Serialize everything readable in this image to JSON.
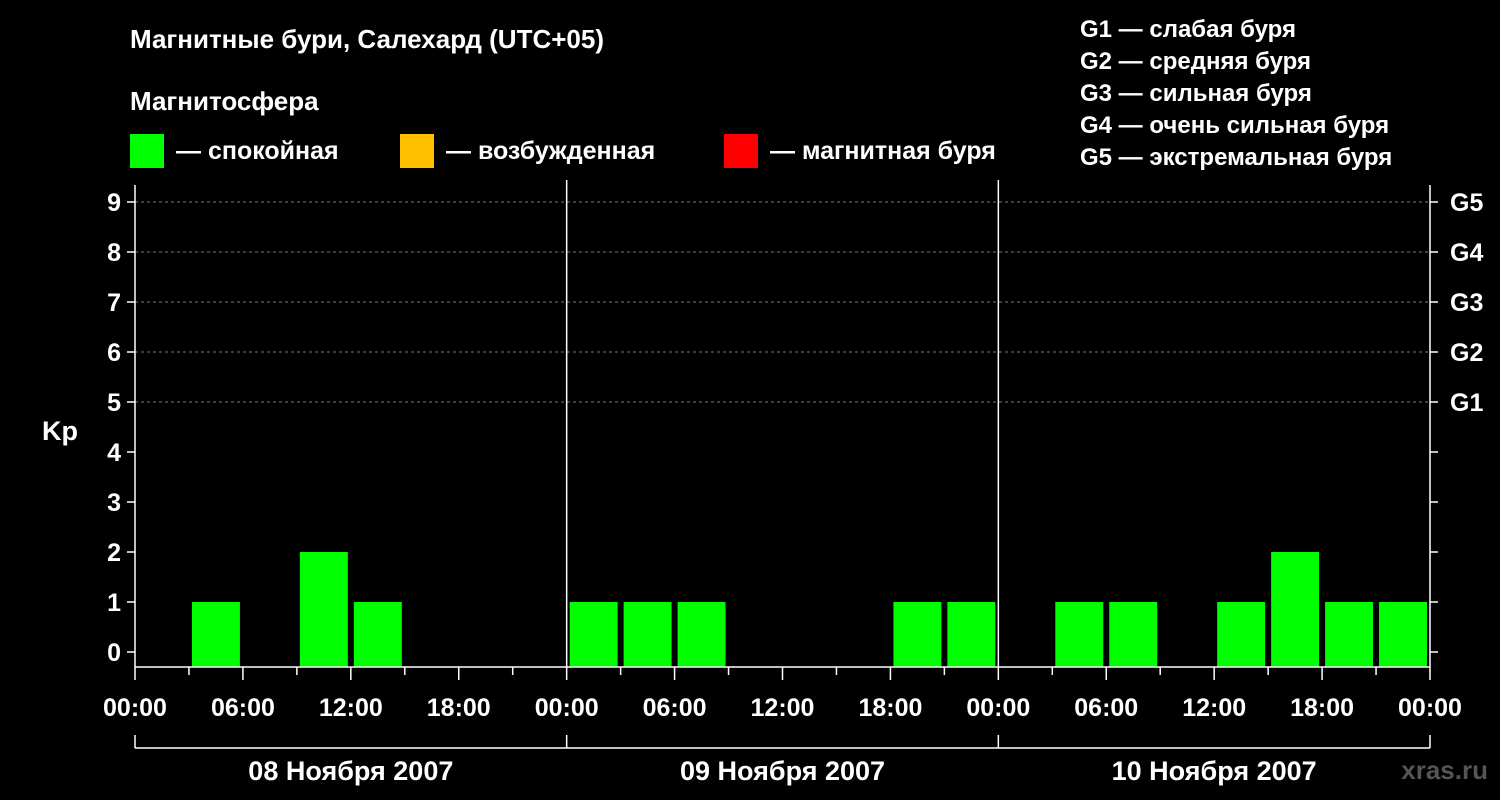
{
  "header": {
    "title": "Магнитные бури, Салехард (UTC+05)",
    "subtitle": "Магнитосфера"
  },
  "legend": [
    {
      "label": "— спокойная",
      "color": "#00ff00"
    },
    {
      "label": "— возбужденная",
      "color": "#ffc000"
    },
    {
      "label": "— магнитная буря",
      "color": "#ff0000"
    }
  ],
  "g_legend": [
    "G1 — слабая буря",
    "G2 — средняя буря",
    "G3 — сильная буря",
    "G4 — очень сильная буря",
    "G5 — экстремальная буря"
  ],
  "watermark": "xras.ru",
  "chart_data": {
    "type": "bar",
    "ylabel": "Kp",
    "ylim": [
      0,
      9
    ],
    "yticks": [
      "0",
      "1",
      "2",
      "3",
      "4",
      "5",
      "6",
      "7",
      "8",
      "9"
    ],
    "right_ticks": [
      {
        "kp": 5,
        "label": "G1"
      },
      {
        "kp": 6,
        "label": "G2"
      },
      {
        "kp": 7,
        "label": "G3"
      },
      {
        "kp": 8,
        "label": "G4"
      },
      {
        "kp": 9,
        "label": "G5"
      }
    ],
    "xticks": [
      "00:00",
      "06:00",
      "12:00",
      "18:00",
      "00:00",
      "06:00",
      "12:00",
      "18:00",
      "00:00",
      "06:00",
      "12:00",
      "18:00",
      "00:00"
    ],
    "days": [
      "08 Ноября 2007",
      "09 Ноября 2007",
      "10 Ноября 2007"
    ],
    "interval_hours": 3,
    "bar_color": "#00ff00",
    "values": [
      [
        0,
        1,
        0,
        2,
        1,
        0,
        0,
        0
      ],
      [
        1,
        1,
        1,
        0,
        0,
        0,
        1,
        1
      ],
      [
        0,
        1,
        1,
        0,
        1,
        2,
        1,
        1
      ]
    ]
  }
}
